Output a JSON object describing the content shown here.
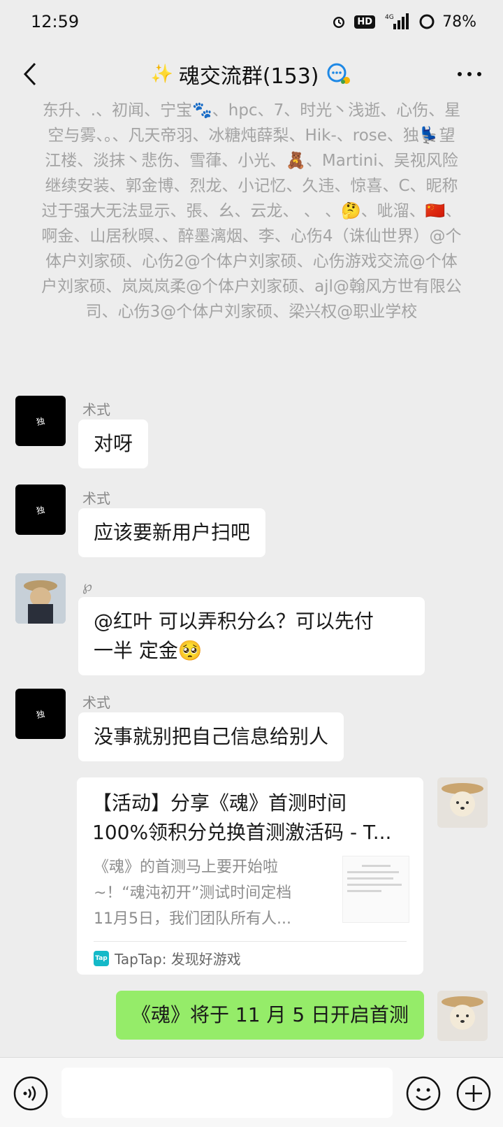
{
  "status_bar": {
    "time": "12:59",
    "network": "4G",
    "battery": "78%",
    "hd": "HD"
  },
  "header": {
    "title": "魂交流群(153)"
  },
  "system_notice": "东升、.、初闻、宁宝🐾、hpc、7、时光丶浅逝、心伤、星空与雾、。、凡天帝羽、冰糖炖薛梨、Hik-、rose、独💺望江楼、淡抹丶悲伤、雪葎、小光、🧸、Martini、吴视风险继续安装、郭金博、烈龙、小记忆、久违、惊喜、C、昵称过于强大无法显示、張、幺、云龙、  、     、🤔、呲溜、🇨🇳、啊金、山居秋暝、、醉墨漓烟、李、心伤4（诛仙世界）@个体户刘家硕、心伤2@个体户刘家硕、心伤游戏交流@个体户刘家硕、岚岚岚柔@个体户刘家硕、ajl@翰风方世有限公司、心伤3@个体户刘家硕、梁兴权@职业学校",
  "messages": [
    {
      "sender": "术式",
      "text": "对呀"
    },
    {
      "sender": "术式",
      "text": "应该要新用户扫吧"
    },
    {
      "sender": "℘",
      "text_line1": "@红叶  可以弄积分么？可以先付",
      "text_line2": "一半 定金🥺"
    },
    {
      "sender": "术式",
      "text": "没事就别把自己信息给别人"
    },
    {
      "type": "link",
      "title_line1": "【活动】分享《魂》首测时间",
      "title_line2": "100%领积分兑换首测激活码 - T...",
      "desc_line1": "《魂》的首测马上要开始啦",
      "desc_line2": "~！“魂沌初开”测试时间定档",
      "desc_line3": "11月5日，我们团队所有人...",
      "source": "TapTap: 发现好游戏",
      "source_icon_label": "Tap"
    },
    {
      "sender": "self",
      "text": "《魂》将于 11 月 5 日开启首测"
    }
  ],
  "avatar_labels": {
    "shushi": "独"
  },
  "colors": {
    "background": "#ededed",
    "bubble_self": "#95ec69",
    "bubble_other": "#ffffff"
  }
}
